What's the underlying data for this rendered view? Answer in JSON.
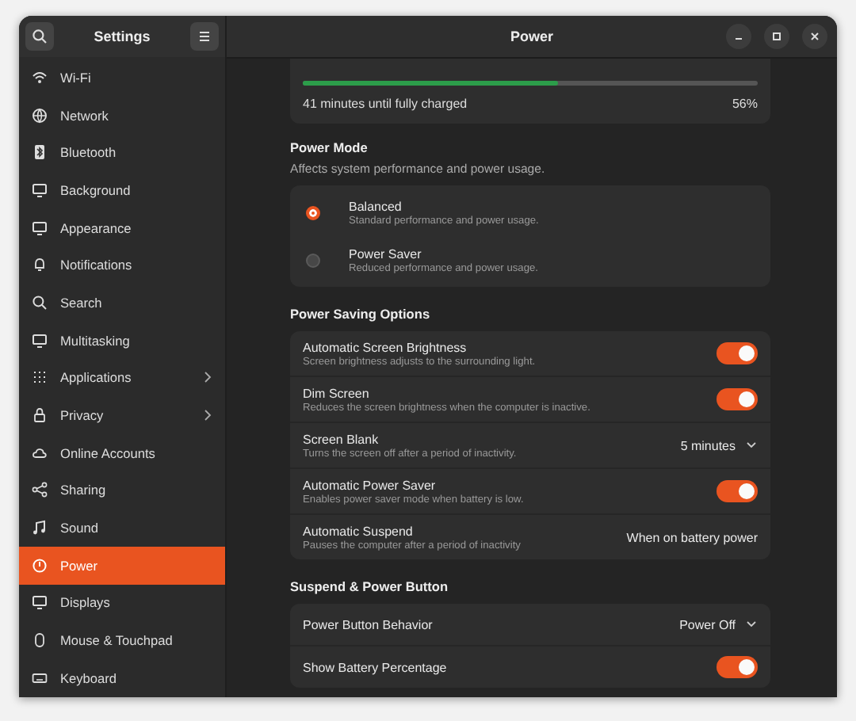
{
  "window": {
    "sidebar_title": "Settings",
    "title": "Power"
  },
  "sidebar": {
    "items": [
      {
        "label": "Wi-Fi",
        "selected": false,
        "has_submenu": false
      },
      {
        "label": "Network",
        "selected": false,
        "has_submenu": false
      },
      {
        "label": "Bluetooth",
        "selected": false,
        "has_submenu": false
      },
      {
        "label": "Background",
        "selected": false,
        "has_submenu": false
      },
      {
        "label": "Appearance",
        "selected": false,
        "has_submenu": false
      },
      {
        "label": "Notifications",
        "selected": false,
        "has_submenu": false
      },
      {
        "label": "Search",
        "selected": false,
        "has_submenu": false
      },
      {
        "label": "Multitasking",
        "selected": false,
        "has_submenu": false
      },
      {
        "label": "Applications",
        "selected": false,
        "has_submenu": true
      },
      {
        "label": "Privacy",
        "selected": false,
        "has_submenu": true
      },
      {
        "label": "Online Accounts",
        "selected": false,
        "has_submenu": false
      },
      {
        "label": "Sharing",
        "selected": false,
        "has_submenu": false
      },
      {
        "label": "Sound",
        "selected": false,
        "has_submenu": false
      },
      {
        "label": "Power",
        "selected": true,
        "has_submenu": false
      },
      {
        "label": "Displays",
        "selected": false,
        "has_submenu": false
      },
      {
        "label": "Mouse & Touchpad",
        "selected": false,
        "has_submenu": false
      },
      {
        "label": "Keyboard",
        "selected": false,
        "has_submenu": false
      }
    ]
  },
  "battery": {
    "level": 0.56,
    "status": "41 minutes until fully charged",
    "percent": "56%"
  },
  "power_mode": {
    "title": "Power Mode",
    "subtitle": "Affects system performance and power usage.",
    "options": [
      {
        "label": "Balanced",
        "description": "Standard performance and power usage.",
        "selected": true
      },
      {
        "label": "Power Saver",
        "description": "Reduced performance and power usage.",
        "selected": false
      }
    ]
  },
  "sections": [
    {
      "title": "Power Saving Options",
      "rows": [
        {
          "kind": "switch",
          "label": "Automatic Screen Brightness",
          "description": "Screen brightness adjusts to the surrounding light.",
          "on": true
        },
        {
          "kind": "switch",
          "label": "Dim Screen",
          "description": "Reduces the screen brightness when the computer is inactive.",
          "on": true
        },
        {
          "kind": "dropdown",
          "label": "Screen Blank",
          "description": "Turns the screen off after a period of inactivity.",
          "value": "5 minutes"
        },
        {
          "kind": "switch",
          "label": "Automatic Power Saver",
          "description": "Enables power saver mode when battery is low.",
          "on": true
        },
        {
          "kind": "value",
          "label": "Automatic Suspend",
          "description": "Pauses the computer after a period of inactivity",
          "value": "When on battery power"
        }
      ]
    },
    {
      "title": "Suspend & Power Button",
      "rows": [
        {
          "kind": "dropdown",
          "label": "Power Button Behavior",
          "value": "Power Off"
        },
        {
          "kind": "switch",
          "label": "Show Battery Percentage",
          "on": true
        }
      ]
    }
  ]
}
